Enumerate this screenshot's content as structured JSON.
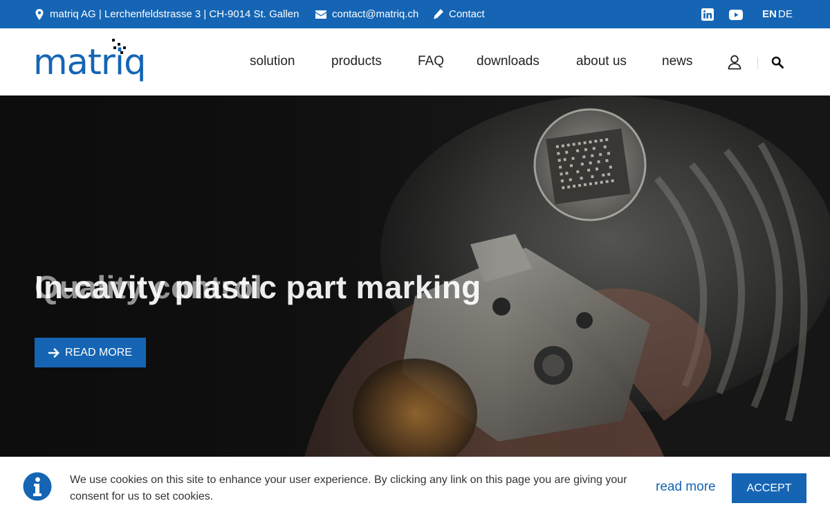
{
  "topbar": {
    "address": "matriq AG | Lerchenfeldstrasse 3 | CH-9014 St. Gallen",
    "email": "contact@matriq.ch",
    "contact": "Contact",
    "lang_active": "EN",
    "lang_other": "DE",
    "icons": [
      "map-pin-icon",
      "envelope-icon",
      "pencil-icon",
      "linkedin-icon",
      "youtube-icon"
    ]
  },
  "header": {
    "logo_text": "matriq",
    "nav": [
      "solution",
      "products",
      "FAQ",
      "downloads",
      "about us",
      "news"
    ],
    "icons": [
      "user-icon",
      "search-icon"
    ]
  },
  "hero": {
    "title_back": "Quality control",
    "title_front": "In-cavity plastic part marking",
    "cta_label": "READ MORE"
  },
  "cookie": {
    "text": "We use cookies on this site to enhance your user experience. By clicking any link on this page you are giving your consent for us to set cookies.",
    "read_more": "read more",
    "accept": "ACCEPT"
  },
  "colors": {
    "brand_blue": "#1565b4",
    "nav_text": "#222222",
    "hero_bg": "#141414"
  }
}
